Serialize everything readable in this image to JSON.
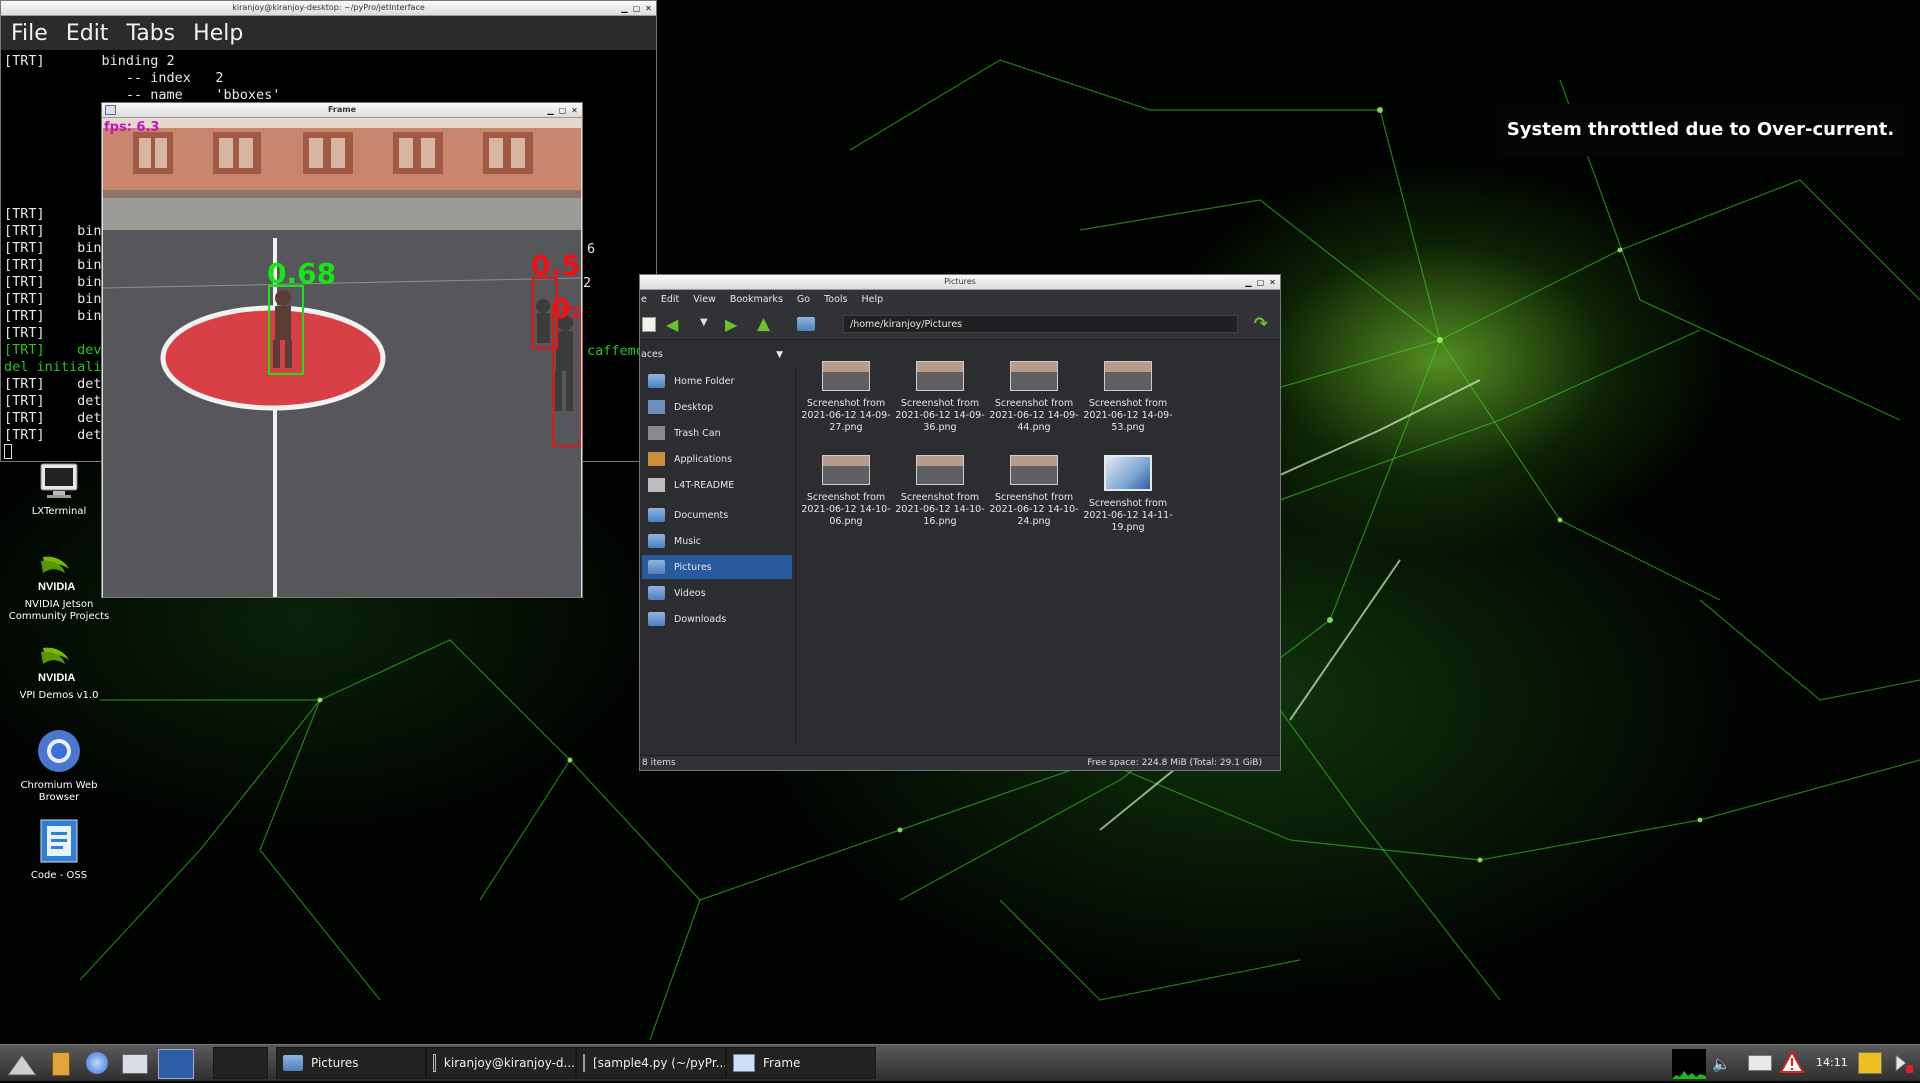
{
  "desktop": {
    "icons": [
      {
        "label": "LXTerminal"
      },
      {
        "label": "NVIDIA Jetson Community Projects"
      },
      {
        "label": "VPI Demos v1.0"
      },
      {
        "label": "Chromium Web Browser"
      },
      {
        "label": "Code - OSS"
      }
    ],
    "nvidia_logo_text": "NVIDIA"
  },
  "notification": {
    "text": "System throttled due to Over-current."
  },
  "terminal": {
    "title": "kiranjoy@kiranjoy-desktop: ~/pyPro/jetInterface",
    "menu": [
      "File",
      "Edit",
      "Tabs",
      "Help"
    ],
    "lines": [
      "[TRT]       binding 2",
      "               -- index   2",
      "               -- name    'bboxes'",
      "",
      "",
      "",
      "",
      "",
      "",
      "[TRT]",
      "[TRT]    bin",
      "[TRT]    bin",
      "[TRT]    bin",
      "[TRT]    bin",
      "[TRT]    bin",
      "[TRT]    bin",
      "[TRT]",
      "[TRT]    dev",
      "del initiali",
      "[TRT]    det",
      "[TRT]    det",
      "[TRT]    det",
      "[TRT]    det"
    ],
    "right_fragments": [
      "6",
      "2",
      "caffemo"
    ]
  },
  "frame_window": {
    "title": "Frame",
    "fps_label": "fps: 6.3",
    "detections": [
      {
        "label": "0.68",
        "color": "#16e616"
      },
      {
        "label": "0.5",
        "color": "#f01010"
      },
      {
        "label": "0.",
        "color": "#f01010"
      }
    ]
  },
  "file_manager": {
    "title": "Pictures",
    "menu": [
      "e",
      "Edit",
      "View",
      "Bookmarks",
      "Go",
      "Tools",
      "Help"
    ],
    "path": "/home/kiranjoy/Pictures",
    "places_label": "aces",
    "sidebar": [
      {
        "label": "Home Folder",
        "icon": "home-folder-icon"
      },
      {
        "label": "Desktop",
        "icon": "desktop-icon"
      },
      {
        "label": "Trash Can",
        "icon": "trash-icon"
      },
      {
        "label": "Applications",
        "icon": "applications-icon"
      },
      {
        "label": "L4T-README",
        "icon": "drive-icon"
      },
      {
        "label": "Documents",
        "icon": "folder-icon"
      },
      {
        "label": "Music",
        "icon": "folder-icon"
      },
      {
        "label": "Pictures",
        "icon": "folder-icon",
        "selected": true
      },
      {
        "label": "Videos",
        "icon": "folder-icon"
      },
      {
        "label": "Downloads",
        "icon": "folder-icon"
      }
    ],
    "files": [
      {
        "name": "Screenshot from 2021-06-12 14-09-27.png"
      },
      {
        "name": "Screenshot from 2021-06-12 14-09-36.png"
      },
      {
        "name": "Screenshot from 2021-06-12 14-09-44.png"
      },
      {
        "name": "Screenshot from 2021-06-12 14-09-53.png"
      },
      {
        "name": "Screenshot from 2021-06-12 14-10-06.png"
      },
      {
        "name": "Screenshot from 2021-06-12 14-10-16.png"
      },
      {
        "name": "Screenshot from 2021-06-12 14-10-24.png"
      },
      {
        "name": "Screenshot from 2021-06-12 14-11-19.png"
      }
    ],
    "status_left": "8 items",
    "status_right": "Free space: 224.8 MiB (Total: 29.1 GiB)"
  },
  "taskbar": {
    "tasks": [
      {
        "label": ""
      },
      {
        "label": "Pictures"
      },
      {
        "label": "kiranjoy@kiranjoy-d..."
      },
      {
        "label": "[sample4.py (~/pyPr..."
      },
      {
        "label": "Frame"
      }
    ],
    "clock": "14:11"
  }
}
